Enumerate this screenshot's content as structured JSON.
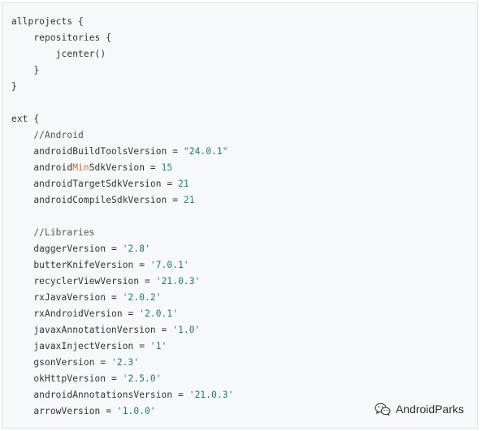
{
  "code": {
    "lines": [
      [
        {
          "t": "allprojects {",
          "c": "plain"
        }
      ],
      [
        {
          "t": "    repositories {",
          "c": "plain"
        }
      ],
      [
        {
          "t": "        jcenter()",
          "c": "plain"
        }
      ],
      [
        {
          "t": "    }",
          "c": "plain"
        }
      ],
      [
        {
          "t": "}",
          "c": "plain"
        }
      ],
      [
        {
          "t": "",
          "c": "plain"
        }
      ],
      [
        {
          "t": "ext {",
          "c": "plain"
        }
      ],
      [
        {
          "t": "    //Android",
          "c": "comment"
        }
      ],
      [
        {
          "t": "    androidBuildToolsVersion = ",
          "c": "plain"
        },
        {
          "t": "\"24.0.1\"",
          "c": "str"
        }
      ],
      [
        {
          "t": "    android",
          "c": "plain"
        },
        {
          "t": "Min",
          "c": "hl"
        },
        {
          "t": "SdkVersion = ",
          "c": "plain"
        },
        {
          "t": "15",
          "c": "num"
        }
      ],
      [
        {
          "t": "    androidTargetSdkVersion = ",
          "c": "plain"
        },
        {
          "t": "21",
          "c": "num"
        }
      ],
      [
        {
          "t": "    androidCompileSdkVersion = ",
          "c": "plain"
        },
        {
          "t": "21",
          "c": "num"
        }
      ],
      [
        {
          "t": "",
          "c": "plain"
        }
      ],
      [
        {
          "t": "    //Libraries",
          "c": "comment"
        }
      ],
      [
        {
          "t": "    daggerVersion = ",
          "c": "plain"
        },
        {
          "t": "'2.8'",
          "c": "str"
        }
      ],
      [
        {
          "t": "    butterKnifeVersion = ",
          "c": "plain"
        },
        {
          "t": "'7.0.1'",
          "c": "str"
        }
      ],
      [
        {
          "t": "    recyclerViewVersion = ",
          "c": "plain"
        },
        {
          "t": "'21.0.3'",
          "c": "str"
        }
      ],
      [
        {
          "t": "    rxJavaVersion = ",
          "c": "plain"
        },
        {
          "t": "'2.0.2'",
          "c": "str"
        }
      ],
      [
        {
          "t": "    rxAndroidVersion = ",
          "c": "plain"
        },
        {
          "t": "'2.0.1'",
          "c": "str"
        }
      ],
      [
        {
          "t": "    javaxAnnotationVersion = ",
          "c": "plain"
        },
        {
          "t": "'1.0'",
          "c": "str"
        }
      ],
      [
        {
          "t": "    javaxInjectVersion = ",
          "c": "plain"
        },
        {
          "t": "'1'",
          "c": "str"
        }
      ],
      [
        {
          "t": "    gsonVersion = ",
          "c": "plain"
        },
        {
          "t": "'2.3'",
          "c": "str"
        }
      ],
      [
        {
          "t": "    okHttpVersion = ",
          "c": "plain"
        },
        {
          "t": "'2.5.0'",
          "c": "str"
        }
      ],
      [
        {
          "t": "    androidAnnotationsVersion = ",
          "c": "plain"
        },
        {
          "t": "'21.0.3'",
          "c": "str"
        }
      ],
      [
        {
          "t": "    arrowVersion = ",
          "c": "plain"
        },
        {
          "t": "'1.0.0'",
          "c": "str"
        }
      ]
    ]
  },
  "watermark": {
    "icon": "wechat-icon",
    "text": "AndroidParks"
  }
}
